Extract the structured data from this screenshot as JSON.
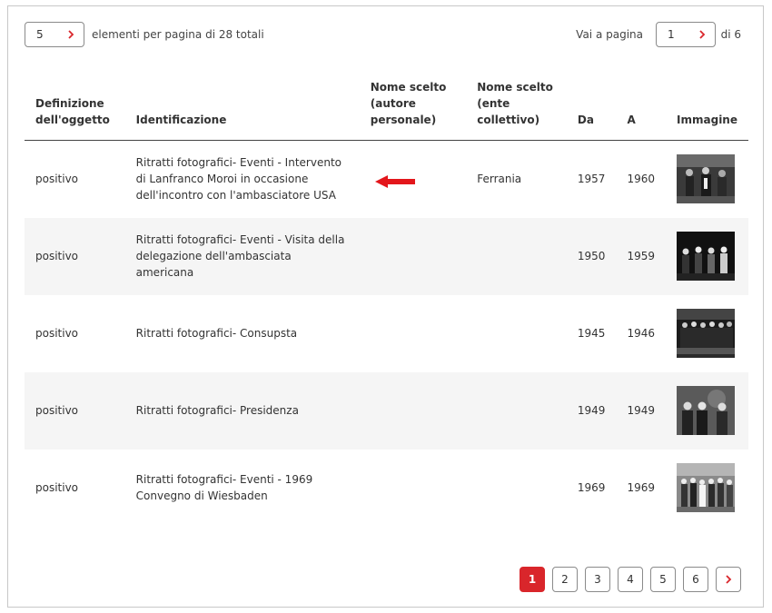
{
  "colors": {
    "accent": "#d9262b",
    "row_alt": "#f5f5f5"
  },
  "top": {
    "per_page_value": "5",
    "per_page_text": "elementi per pagina di 28 totali",
    "goto_label": "Vai a pagina",
    "goto_value": "1",
    "goto_of": "di 6"
  },
  "table": {
    "headers": {
      "definizione": "Definizione dell'oggetto",
      "identificazione": "Identificazione",
      "autore": "Nome scelto (autore personale)",
      "ente": "Nome scelto (ente collettivo)",
      "da": "Da",
      "a": "A",
      "immagine": "Immagine"
    },
    "rows": [
      {
        "definizione": "positivo",
        "identificazione": "Ritratti fotografici- Eventi - Intervento di Lanfranco Moroi in occasione dell'incontro con l'ambasciatore USA",
        "autore": "",
        "ente": "Ferrania",
        "da": "1957",
        "a": "1960"
      },
      {
        "definizione": "positivo",
        "identificazione": "Ritratti fotografici- Eventi - Visita della delegazione dell'ambasciata americana",
        "autore": "",
        "ente": "",
        "da": "1950",
        "a": "1959"
      },
      {
        "definizione": "positivo",
        "identificazione": "Ritratti fotografici- Consupsta",
        "autore": "",
        "ente": "",
        "da": "1945",
        "a": "1946"
      },
      {
        "definizione": "positivo",
        "identificazione": "Ritratti fotografici- Presidenza",
        "autore": "",
        "ente": "",
        "da": "1949",
        "a": "1949"
      },
      {
        "definizione": "positivo",
        "identificazione": "Ritratti fotografici- Eventi - 1969 Convegno di Wiesbaden",
        "autore": "",
        "ente": "",
        "da": "1969",
        "a": "1969"
      }
    ]
  },
  "pagination": {
    "pages": [
      "1",
      "2",
      "3",
      "4",
      "5",
      "6"
    ],
    "current": "1",
    "next_icon": "chevron-right-icon"
  },
  "annotation": {
    "icon": "red-arrow-left-icon"
  }
}
